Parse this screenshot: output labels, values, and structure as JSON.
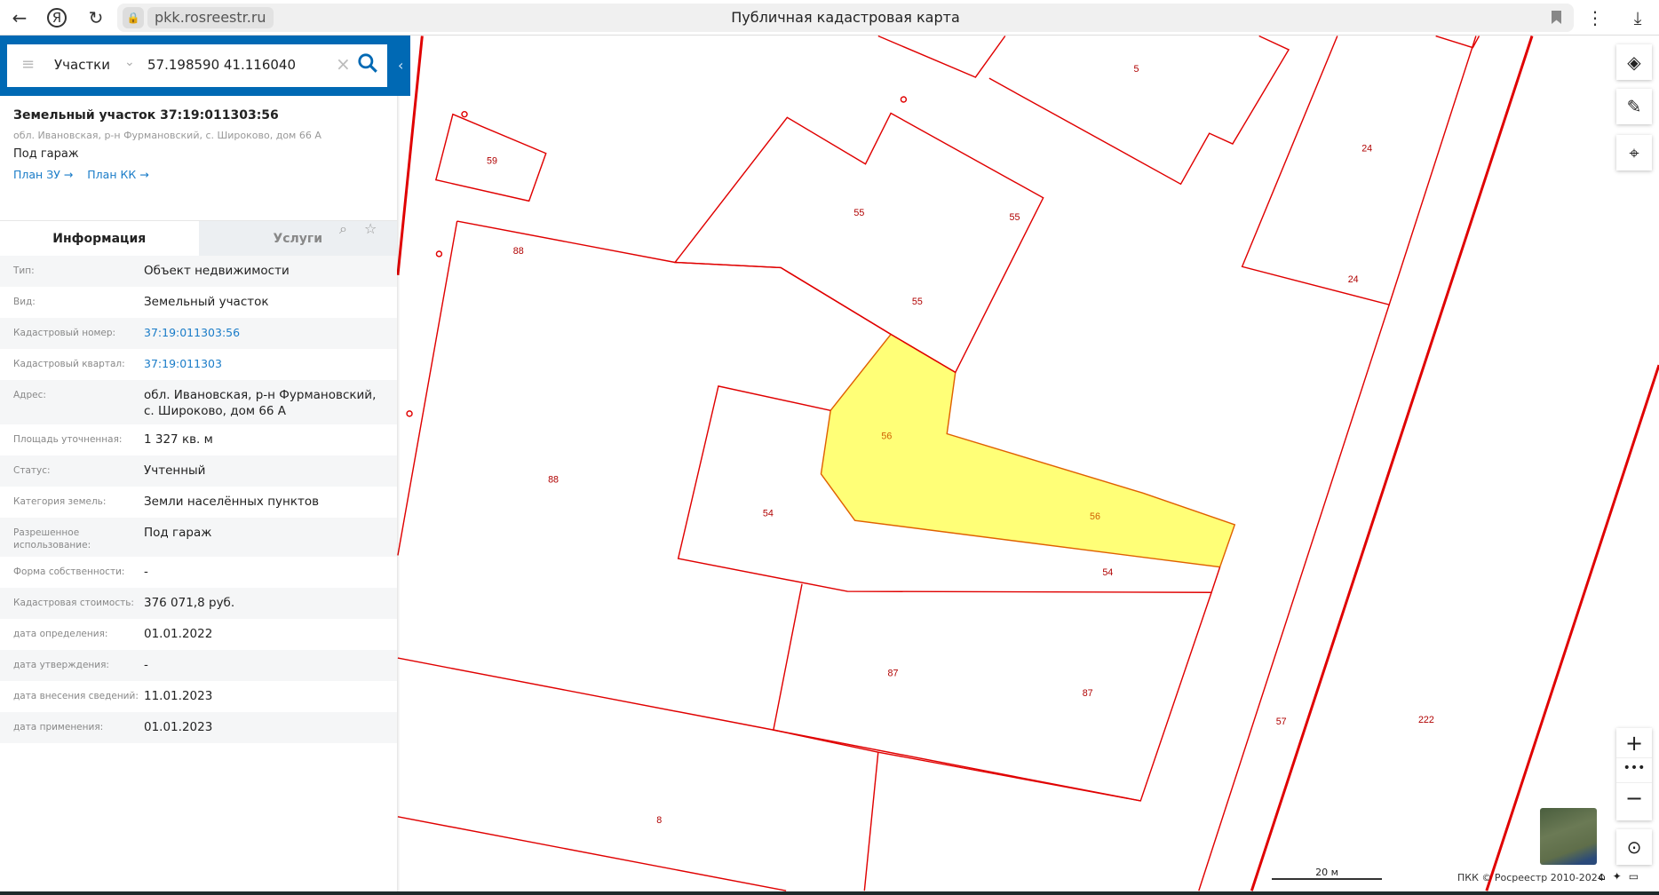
{
  "browser": {
    "url": "pkk.rosreestr.ru",
    "title": "Публичная кадастровая карта"
  },
  "search": {
    "category": "Участки",
    "query": "57.198590 41.116040"
  },
  "card": {
    "title": "Земельный участок 37:19:011303:56",
    "address": "обл. Ивановская, р-н Фурмановский, с. Широково, дом 66 А",
    "use": "Под гараж",
    "link_plan_zu": "План ЗУ →",
    "link_plan_kk": "План КК →"
  },
  "tabs": [
    "Информация",
    "Услуги"
  ],
  "info": [
    {
      "k": "Тип:",
      "v": "Объект недвижимости"
    },
    {
      "k": "Вид:",
      "v": "Земельный участок"
    },
    {
      "k": "Кадастровый номер:",
      "v": "37:19:011303:56"
    },
    {
      "k": "Кадастровый квартал:",
      "v": "37:19:011303"
    },
    {
      "k": "Адрес:",
      "v": "обл. Ивановская, р-н Фурмановский, с. Широково, дом 66 А"
    },
    {
      "k": "Площадь уточненная:",
      "v": "1 327 кв. м"
    },
    {
      "k": "Статус:",
      "v": "Учтенный"
    },
    {
      "k": "Категория земель:",
      "v": "Земли населённых пунктов"
    },
    {
      "k": "Разрешенное использование:",
      "v": "Под гараж"
    },
    {
      "k": "Форма собственности:",
      "v": "-"
    },
    {
      "k": "Кадастровая стоимость:",
      "v": "376 071,8 руб."
    },
    {
      "k": "дата определения:",
      "v": "01.01.2022"
    },
    {
      "k": "дата утверждения:",
      "v": "-"
    },
    {
      "k": "дата внесения сведений:",
      "v": "11.01.2023"
    },
    {
      "k": "дата применения:",
      "v": "01.01.2023"
    }
  ],
  "map": {
    "labels": [
      "5",
      "59",
      "55",
      "55",
      "55",
      "88",
      "24",
      "24",
      "56",
      "56",
      "88",
      "54",
      "54",
      "87",
      "87",
      "57",
      "222",
      "8"
    ],
    "scale": "20 м",
    "copyright": "ПКК © Росреестр 2010-2024",
    "colors": {
      "boundary": "#e00000",
      "selected": "#ffff77"
    }
  }
}
